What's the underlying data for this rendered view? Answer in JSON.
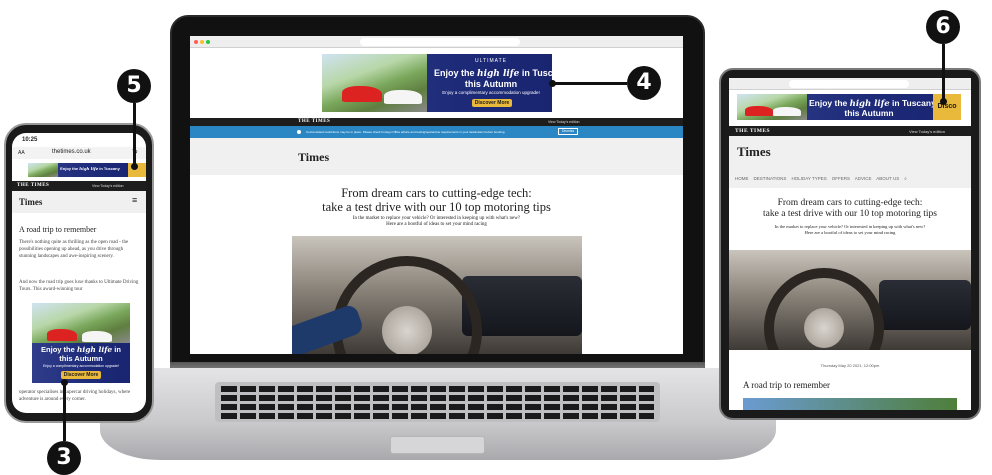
{
  "callouts": {
    "c3": "3",
    "c4": "4",
    "c5": "5",
    "c6": "6"
  },
  "ad": {
    "brand": "ULTIMATE",
    "line1_pre": "Enjoy the",
    "line1_script": "high life",
    "line1_post": "in Tuscany",
    "line2": "this Autumn",
    "subline": "Enjoy a complimentary accommodation upgrade!",
    "cta": "Discover More",
    "tablet_cta_partial": "Disco"
  },
  "laptop": {
    "masthead_logo": "THE TIMES",
    "masthead_link": "View Today's edition",
    "notice": "Covid-related restrictions may be in place. Please check Foreign Office advice and testing/quarantine requirements in your destination before booking.",
    "notice_button": "Dismiss",
    "section_title": "Times",
    "headline_1": "From dream cars to cutting-edge tech:",
    "headline_2": "take a test drive with our 10 top motoring tips",
    "standfirst_1": "In the market to replace your vehicle? Or interested in keeping up with what's new?",
    "standfirst_2": "Here are a bootful of ideas to set your mind racing"
  },
  "phone": {
    "time": "10:25",
    "aa": "AA",
    "url": "thetimes.co.uk",
    "masthead_logo": "THE TIMES",
    "masthead_link": "View Today's edition",
    "section_title": "Times",
    "article_title": "A road trip to remember",
    "para1": "There's nothing quite as thrilling as the open road - the possibilities opening up ahead, as you drive through stunning landscapes and awe-inspiring scenery.",
    "para2": "And now the road trip goes luxe thanks to Ultimate Driving Tours. This award-winning tour",
    "para3": "operator specialises in supercar driving holidays, where adventure is around every corner."
  },
  "tablet": {
    "masthead_logo": "THE TIMES",
    "masthead_link": "View Today's edition",
    "section_title": "Times",
    "nav": [
      "HOME",
      "DESTINATIONS",
      "HOLIDAY TYPES",
      "OFFERS",
      "ADVICE",
      "ABOUT US"
    ],
    "headline_1": "From dream cars to cutting-edge tech:",
    "headline_2": "take a test drive with our 10 top motoring tips",
    "standfirst_1": "In the market to replace your vehicle? Or interested in keeping up with what's new?",
    "standfirst_2": "Here are a bootful of ideas to set your mind racing",
    "dateline": "Thursday May 20 2021, 12:00pm",
    "article_title": "A road trip to remember"
  }
}
